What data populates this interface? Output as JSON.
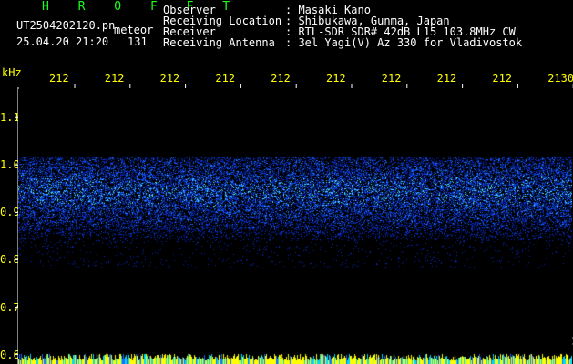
{
  "header": {
    "logo": "H R O F F T",
    "filename": "UT2504202120.pn",
    "detect_label": "meteor",
    "date_time": "25.04.20 21:20",
    "count": "131",
    "labels": [
      "Observer",
      "Receiving Location",
      "Receiver",
      "Receiving Antenna"
    ],
    "values": [
      ": Masaki Kano",
      ": Shibukawa, Gunma, Japan",
      ": RTL-SDR SDR# 42dB L15 103.8MHz CW",
      ": 3el Yagi(V) Az 330 for Vladivostok"
    ]
  },
  "colors": {
    "logo": "#1aff1a",
    "labels": "#ffffff",
    "axis_labels": "#ffff00",
    "background": "#000000",
    "signal_low": "#0a1aff",
    "signal_high": "#4fe3ff"
  },
  "chart_data": {
    "type": "heatmap",
    "ylabel": "kHz",
    "x_tick_labels": [
      "212",
      "212",
      "212",
      "212",
      "212",
      "212",
      "212",
      "212",
      "212",
      "2130"
    ],
    "y_tick_labels": [
      "1.1",
      "1.0",
      "0.9",
      "0.8",
      "0.7",
      "0.6"
    ],
    "y_tick_values": [
      1.1,
      1.0,
      0.9,
      0.8,
      0.7,
      0.6
    ],
    "ylim": [
      0.58,
      1.16
    ],
    "noise_band": [
      0.79,
      1.01
    ],
    "noise_peak": 0.945,
    "grid": false
  }
}
